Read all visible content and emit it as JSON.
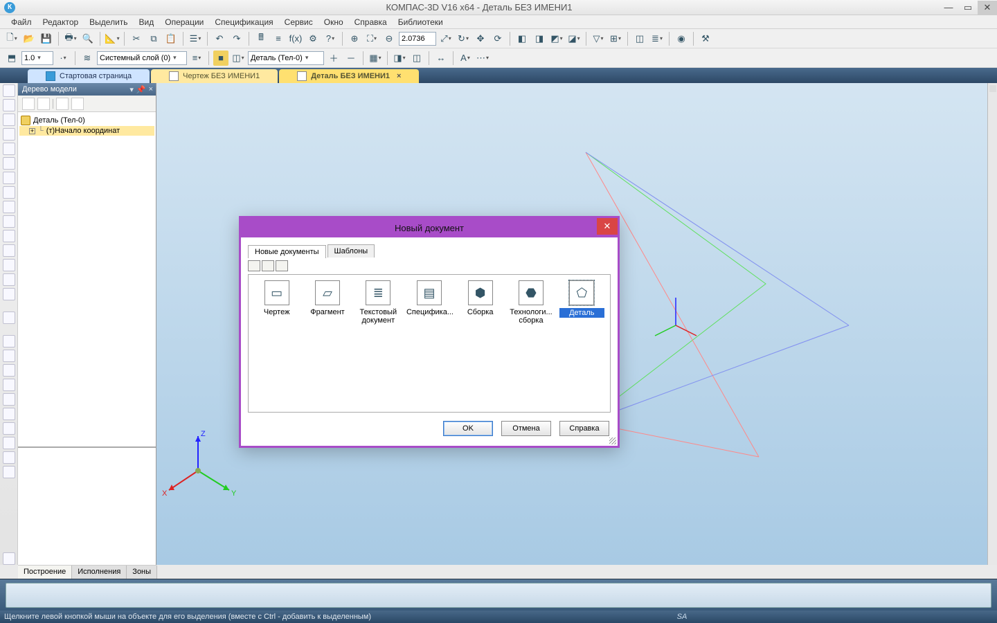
{
  "title": "КОМПАС-3D V16  x64 - Деталь БЕЗ ИМЕНИ1",
  "menu": [
    "Файл",
    "Редактор",
    "Выделить",
    "Вид",
    "Операции",
    "Спецификация",
    "Сервис",
    "Окно",
    "Справка",
    "Библиотеки"
  ],
  "toolbar1": {
    "zoom_value": "2.0736"
  },
  "toolbar2": {
    "scale": "1.0",
    "layer": "Системный слой (0)",
    "part": "Деталь (Тел-0)"
  },
  "doctabs": [
    {
      "label": "Стартовая страница",
      "kind": "blue",
      "closable": false
    },
    {
      "label": "Чертеж БЕЗ ИМЕНИ1",
      "kind": "yellow",
      "closable": false
    },
    {
      "label": "Деталь БЕЗ ИМЕНИ1",
      "kind": "yellow",
      "closable": true,
      "active": true
    }
  ],
  "sidepanel": {
    "title": "Дерево модели",
    "root": "Деталь (Тел-0)",
    "child": "(т)Начало координат",
    "tabs": [
      "Построение",
      "Исполнения",
      "Зоны"
    ]
  },
  "dialog": {
    "title": "Новый документ",
    "tabs": [
      "Новые документы",
      "Шаблоны"
    ],
    "items": [
      {
        "label": "Чертеж"
      },
      {
        "label": "Фрагмент"
      },
      {
        "label": "Текстовый документ",
        "two": true,
        "label2": "документ",
        "label1": "Текстовый"
      },
      {
        "label": "Специфика..."
      },
      {
        "label": "Сборка"
      },
      {
        "label": "Технологи...",
        "two": true,
        "label1": "Технологи...",
        "label2": "сборка"
      },
      {
        "label": "Деталь",
        "selected": true
      }
    ],
    "buttons": {
      "ok": "OK",
      "cancel": "Отмена",
      "help": "Справка"
    }
  },
  "status": "Щелкните левой кнопкой мыши на объекте для его выделения (вместе с Ctrl - добавить к выделенным)",
  "status_right": "SA"
}
